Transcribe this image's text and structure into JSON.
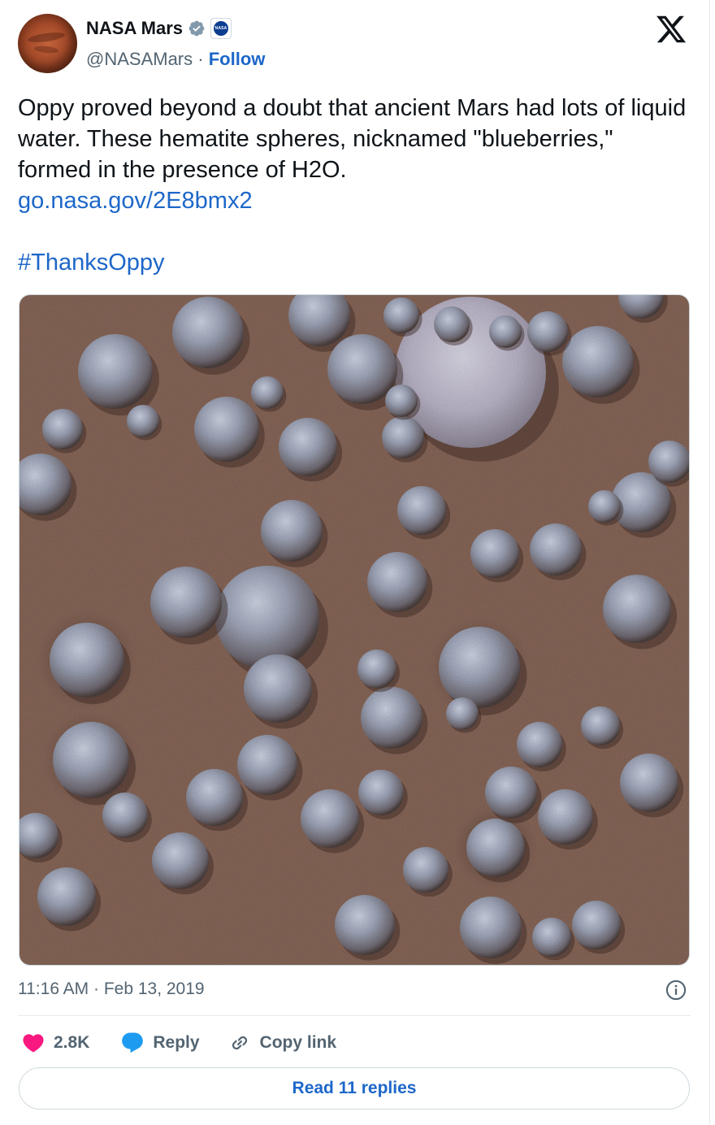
{
  "author": {
    "display_name": "NASA Mars",
    "handle": "@NASAMars",
    "separator": "·",
    "follow_label": "Follow",
    "affiliate_badge_text": "NASA"
  },
  "tweet": {
    "text": "Oppy proved beyond a doubt that ancient Mars had lots of liquid water. These hematite spheres, nicknamed \"blueberries,\" formed in the presence of H2O.",
    "link": "go.nasa.gov/2E8bmx2",
    "hashtag": "#ThanksOppy",
    "timestamp": "11:16 AM · Feb 13, 2019"
  },
  "icons": {
    "verified": "verified-badge-icon",
    "platform": "x-logo-icon",
    "info": "info-icon",
    "like": "heart-icon",
    "reply": "speech-bubble-icon",
    "copy": "link-icon"
  },
  "actions": {
    "like_count": "2.8K",
    "reply_label": "Reply",
    "copy_label": "Copy link"
  },
  "read_replies_label": "Read 11 replies",
  "colors": {
    "link": "#1d67c9",
    "heart": "#f91880",
    "reply_bubble": "#1d9bf0",
    "verified": "#829aab",
    "secondary_text": "#536471"
  }
}
